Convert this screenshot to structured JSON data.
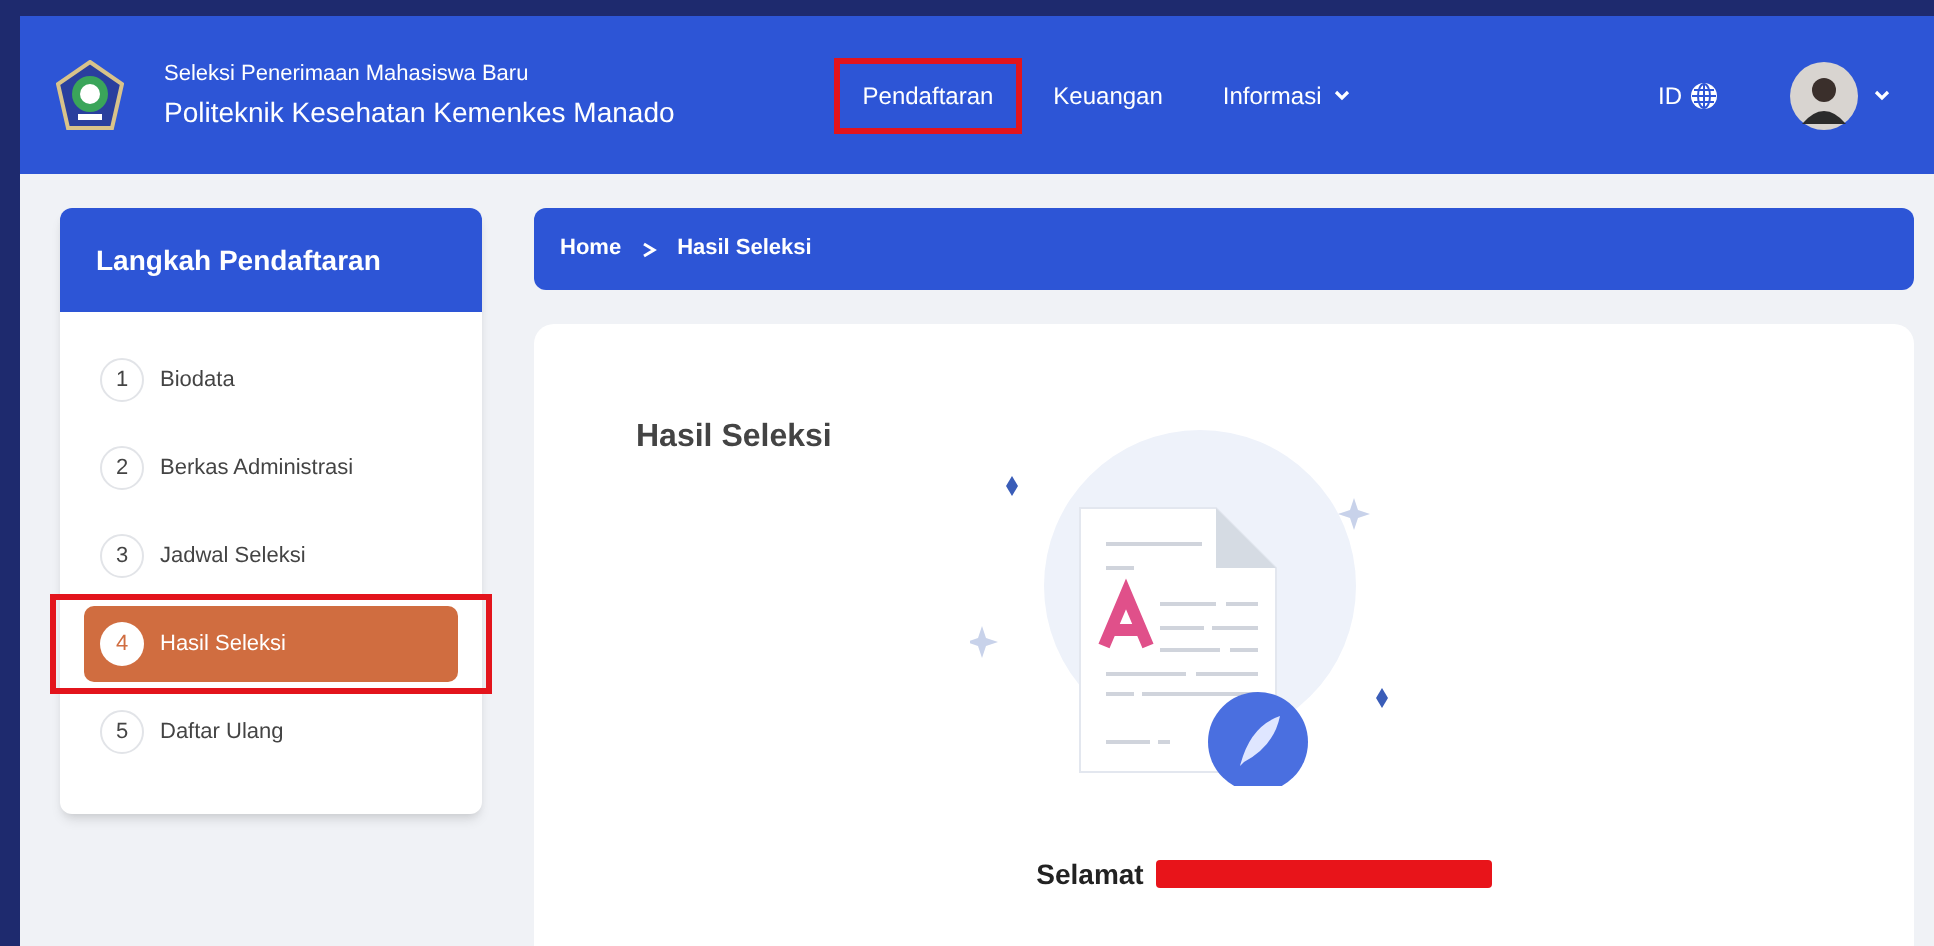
{
  "header": {
    "subtitle": "Seleksi Penerimaan Mahasiswa Baru",
    "title": "Politeknik Kesehatan Kemenkes Manado",
    "nav": [
      {
        "label": "Pendaftaran",
        "dropdown": false,
        "highlighted": true
      },
      {
        "label": "Keuangan",
        "dropdown": false,
        "highlighted": false
      },
      {
        "label": "Informasi",
        "dropdown": true,
        "highlighted": false
      }
    ],
    "language": "ID"
  },
  "sidebar": {
    "title": "Langkah Pendaftaran",
    "steps": [
      {
        "number": "1",
        "label": "Biodata",
        "selected": false,
        "highlighted": false
      },
      {
        "number": "2",
        "label": "Berkas Administrasi",
        "selected": false,
        "highlighted": false
      },
      {
        "number": "3",
        "label": "Jadwal Seleksi",
        "selected": false,
        "highlighted": false
      },
      {
        "number": "4",
        "label": "Hasil Seleksi",
        "selected": true,
        "highlighted": true
      },
      {
        "number": "5",
        "label": "Daftar Ulang",
        "selected": false,
        "highlighted": false
      }
    ]
  },
  "breadcrumb": [
    "Home",
    "Hasil Seleksi"
  ],
  "main": {
    "title": "Hasil Seleksi",
    "message": "Selamat"
  }
}
